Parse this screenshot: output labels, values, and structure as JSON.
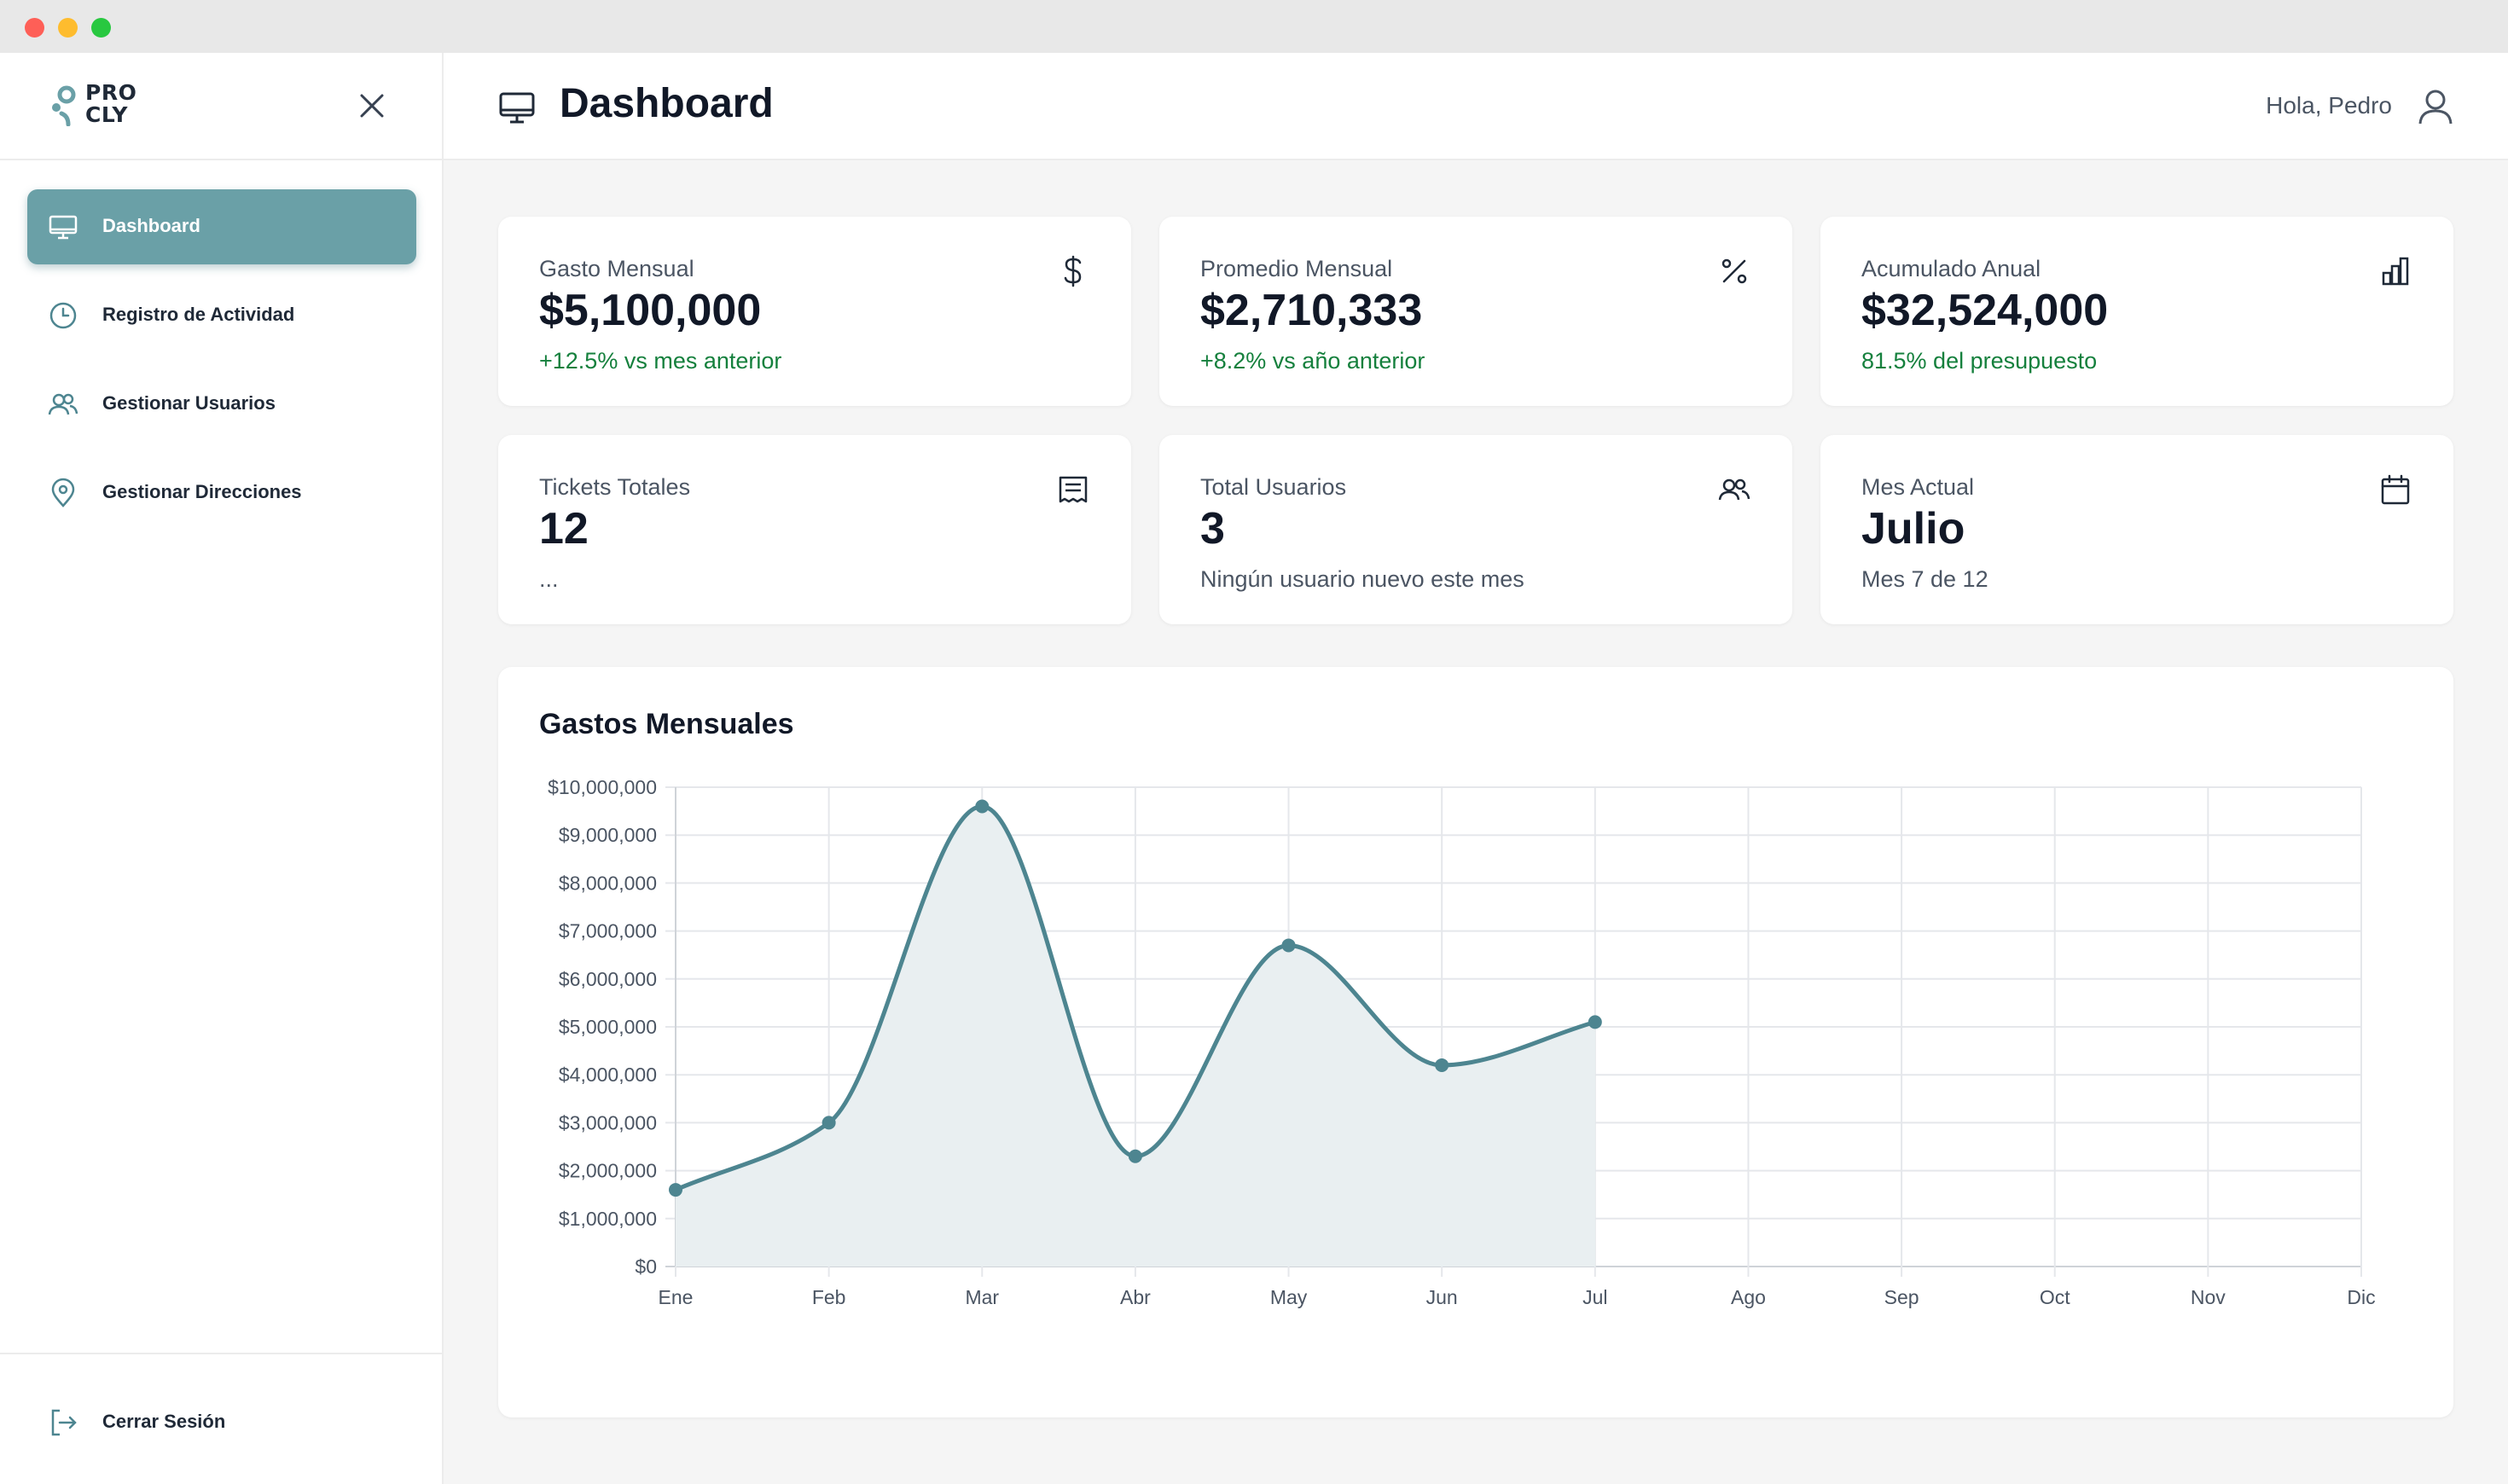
{
  "app": {
    "logo_line1": "PRO",
    "logo_line2": "CLY"
  },
  "sidebar": {
    "items": [
      {
        "label": "Dashboard",
        "icon": "monitor-icon",
        "active": true
      },
      {
        "label": "Registro de Actividad",
        "icon": "clock-icon",
        "active": false
      },
      {
        "label": "Gestionar Usuarios",
        "icon": "users-icon",
        "active": false
      },
      {
        "label": "Gestionar Direcciones",
        "icon": "map-pin-icon",
        "active": false
      }
    ],
    "logout_label": "Cerrar Sesión"
  },
  "header": {
    "title": "Dashboard",
    "greeting": "Hola, Pedro"
  },
  "stats": [
    {
      "label": "Gasto Mensual",
      "value": "$5,100,000",
      "sub": "+12.5% vs mes anterior",
      "icon": "dollar-icon",
      "sub_color": "green"
    },
    {
      "label": "Promedio Mensual",
      "value": "$2,710,333",
      "sub": "+8.2% vs año anterior",
      "icon": "percent-icon",
      "sub_color": "green"
    },
    {
      "label": "Acumulado Anual",
      "value": "$32,524,000",
      "sub": "81.5% del presupuesto",
      "icon": "bar-chart-icon",
      "sub_color": "green"
    },
    {
      "label": "Tickets Totales",
      "value": "12",
      "sub": "...",
      "icon": "ticket-icon",
      "sub_color": "gray"
    },
    {
      "label": "Total Usuarios",
      "value": "3",
      "sub": "Ningún usuario nuevo este mes",
      "icon": "users-icon",
      "sub_color": "gray"
    },
    {
      "label": "Mes Actual",
      "value": "Julio",
      "sub": "Mes 7 de 12",
      "icon": "calendar-icon",
      "sub_color": "gray"
    }
  ],
  "colors": {
    "accent": "#6aa0a7",
    "line": "#4d8590",
    "fill": "#e9eff1",
    "positive": "#15803d"
  },
  "chart_data": {
    "type": "area",
    "title": "Gastos Mensuales",
    "categories": [
      "Ene",
      "Feb",
      "Mar",
      "Abr",
      "May",
      "Jun",
      "Jul",
      "Ago",
      "Sep",
      "Oct",
      "Nov",
      "Dic"
    ],
    "values": [
      1600000,
      3000000,
      9600000,
      2300000,
      6700000,
      4200000,
      5100000,
      null,
      null,
      null,
      null,
      null
    ],
    "ylim": [
      0,
      10000000
    ],
    "yticks": [
      "$0",
      "$1,000,000",
      "$2,000,000",
      "$3,000,000",
      "$4,000,000",
      "$5,000,000",
      "$6,000,000",
      "$7,000,000",
      "$8,000,000",
      "$9,000,000",
      "$10,000,000"
    ],
    "grid": true,
    "legend": "none"
  }
}
